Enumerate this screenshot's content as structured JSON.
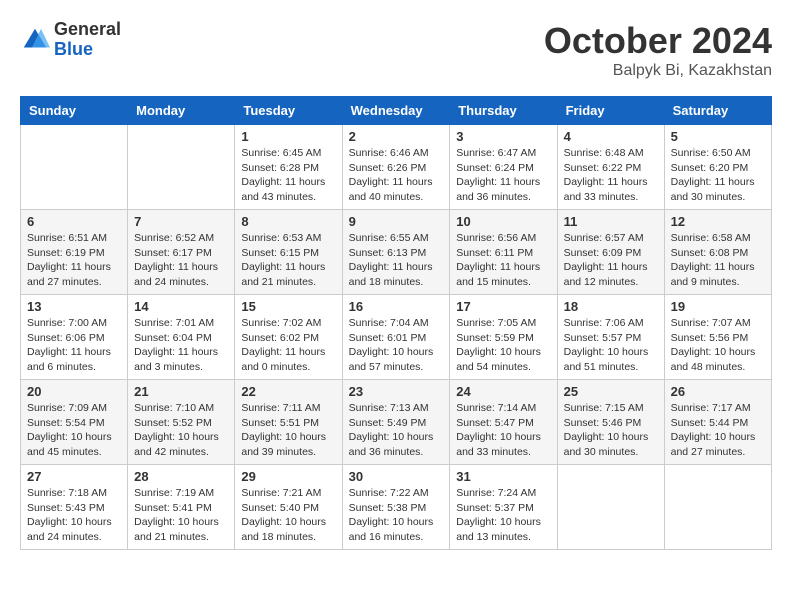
{
  "logo": {
    "general": "General",
    "blue": "Blue"
  },
  "title": "October 2024",
  "location": "Balpyk Bi, Kazakhstan",
  "days_of_week": [
    "Sunday",
    "Monday",
    "Tuesday",
    "Wednesday",
    "Thursday",
    "Friday",
    "Saturday"
  ],
  "weeks": [
    [
      null,
      null,
      {
        "day": 1,
        "sunrise": "6:45 AM",
        "sunset": "6:28 PM",
        "daylight": "11 hours and 43 minutes."
      },
      {
        "day": 2,
        "sunrise": "6:46 AM",
        "sunset": "6:26 PM",
        "daylight": "11 hours and 40 minutes."
      },
      {
        "day": 3,
        "sunrise": "6:47 AM",
        "sunset": "6:24 PM",
        "daylight": "11 hours and 36 minutes."
      },
      {
        "day": 4,
        "sunrise": "6:48 AM",
        "sunset": "6:22 PM",
        "daylight": "11 hours and 33 minutes."
      },
      {
        "day": 5,
        "sunrise": "6:50 AM",
        "sunset": "6:20 PM",
        "daylight": "11 hours and 30 minutes."
      }
    ],
    [
      {
        "day": 6,
        "sunrise": "6:51 AM",
        "sunset": "6:19 PM",
        "daylight": "11 hours and 27 minutes."
      },
      {
        "day": 7,
        "sunrise": "6:52 AM",
        "sunset": "6:17 PM",
        "daylight": "11 hours and 24 minutes."
      },
      {
        "day": 8,
        "sunrise": "6:53 AM",
        "sunset": "6:15 PM",
        "daylight": "11 hours and 21 minutes."
      },
      {
        "day": 9,
        "sunrise": "6:55 AM",
        "sunset": "6:13 PM",
        "daylight": "11 hours and 18 minutes."
      },
      {
        "day": 10,
        "sunrise": "6:56 AM",
        "sunset": "6:11 PM",
        "daylight": "11 hours and 15 minutes."
      },
      {
        "day": 11,
        "sunrise": "6:57 AM",
        "sunset": "6:09 PM",
        "daylight": "11 hours and 12 minutes."
      },
      {
        "day": 12,
        "sunrise": "6:58 AM",
        "sunset": "6:08 PM",
        "daylight": "11 hours and 9 minutes."
      }
    ],
    [
      {
        "day": 13,
        "sunrise": "7:00 AM",
        "sunset": "6:06 PM",
        "daylight": "11 hours and 6 minutes."
      },
      {
        "day": 14,
        "sunrise": "7:01 AM",
        "sunset": "6:04 PM",
        "daylight": "11 hours and 3 minutes."
      },
      {
        "day": 15,
        "sunrise": "7:02 AM",
        "sunset": "6:02 PM",
        "daylight": "11 hours and 0 minutes."
      },
      {
        "day": 16,
        "sunrise": "7:04 AM",
        "sunset": "6:01 PM",
        "daylight": "10 hours and 57 minutes."
      },
      {
        "day": 17,
        "sunrise": "7:05 AM",
        "sunset": "5:59 PM",
        "daylight": "10 hours and 54 minutes."
      },
      {
        "day": 18,
        "sunrise": "7:06 AM",
        "sunset": "5:57 PM",
        "daylight": "10 hours and 51 minutes."
      },
      {
        "day": 19,
        "sunrise": "7:07 AM",
        "sunset": "5:56 PM",
        "daylight": "10 hours and 48 minutes."
      }
    ],
    [
      {
        "day": 20,
        "sunrise": "7:09 AM",
        "sunset": "5:54 PM",
        "daylight": "10 hours and 45 minutes."
      },
      {
        "day": 21,
        "sunrise": "7:10 AM",
        "sunset": "5:52 PM",
        "daylight": "10 hours and 42 minutes."
      },
      {
        "day": 22,
        "sunrise": "7:11 AM",
        "sunset": "5:51 PM",
        "daylight": "10 hours and 39 minutes."
      },
      {
        "day": 23,
        "sunrise": "7:13 AM",
        "sunset": "5:49 PM",
        "daylight": "10 hours and 36 minutes."
      },
      {
        "day": 24,
        "sunrise": "7:14 AM",
        "sunset": "5:47 PM",
        "daylight": "10 hours and 33 minutes."
      },
      {
        "day": 25,
        "sunrise": "7:15 AM",
        "sunset": "5:46 PM",
        "daylight": "10 hours and 30 minutes."
      },
      {
        "day": 26,
        "sunrise": "7:17 AM",
        "sunset": "5:44 PM",
        "daylight": "10 hours and 27 minutes."
      }
    ],
    [
      {
        "day": 27,
        "sunrise": "7:18 AM",
        "sunset": "5:43 PM",
        "daylight": "10 hours and 24 minutes."
      },
      {
        "day": 28,
        "sunrise": "7:19 AM",
        "sunset": "5:41 PM",
        "daylight": "10 hours and 21 minutes."
      },
      {
        "day": 29,
        "sunrise": "7:21 AM",
        "sunset": "5:40 PM",
        "daylight": "10 hours and 18 minutes."
      },
      {
        "day": 30,
        "sunrise": "7:22 AM",
        "sunset": "5:38 PM",
        "daylight": "10 hours and 16 minutes."
      },
      {
        "day": 31,
        "sunrise": "7:24 AM",
        "sunset": "5:37 PM",
        "daylight": "10 hours and 13 minutes."
      },
      null,
      null
    ]
  ]
}
